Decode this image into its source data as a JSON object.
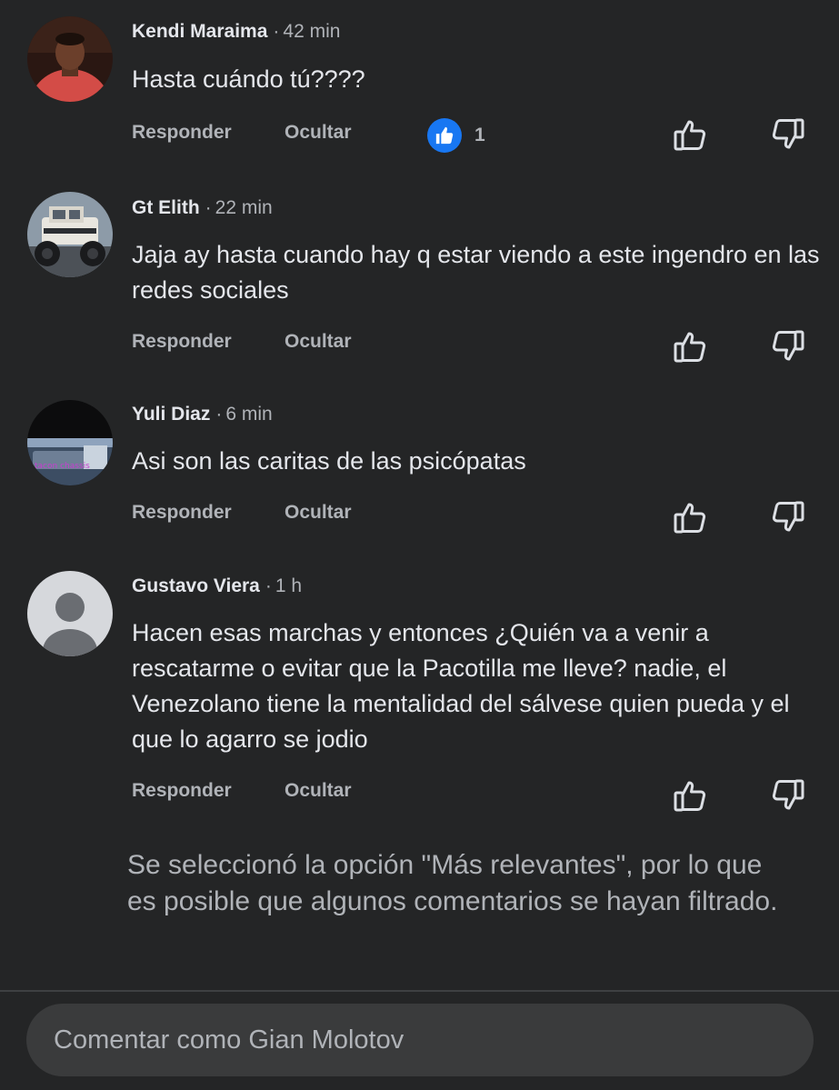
{
  "comments": [
    {
      "author": "Kendi Maraima",
      "time": "42 min",
      "text": "Hasta cuándo tú????",
      "reply_label": "Responder",
      "hide_label": "Ocultar",
      "reaction_count": "1",
      "avatar": "photo-man-red-shirt"
    },
    {
      "author": "Gt Elith",
      "time": "22 min",
      "text": "Jaja ay hasta cuando hay q estar viendo a este ingendro en las redes sociales",
      "reply_label": "Responder",
      "hide_label": "Ocultar",
      "avatar": "photo-white-truck"
    },
    {
      "author": "Yuli Diaz",
      "time": "6 min",
      "text": "Asi son las caritas de las psicópatas",
      "reply_label": "Responder",
      "hide_label": "Ocultar",
      "avatar": "photo-dark-car",
      "avatar_caption": "tacon chassis"
    },
    {
      "author": "Gustavo Viera",
      "time": "1 h",
      "text": "Hacen esas marchas y entonces ¿Quién va a venir a rescatarme o evitar que la Pacotilla me lleve? nadie, el Venezolano tiene la mentalidad del sálvese quien pueda y el que lo agarro se jodio",
      "reply_label": "Responder",
      "hide_label": "Ocultar",
      "avatar": "default-silhouette"
    }
  ],
  "separator": "·",
  "notice": "Se seleccionó la opción \"Más relevantes\", por lo que es posible que algunos comentarios se hayan filtrado.",
  "composer": {
    "placeholder": "Comentar como Gian Molotov"
  },
  "colors": {
    "background": "#242526",
    "text": "#e4e6eb",
    "secondary": "#b0b3b8",
    "accent": "#1877f2"
  }
}
